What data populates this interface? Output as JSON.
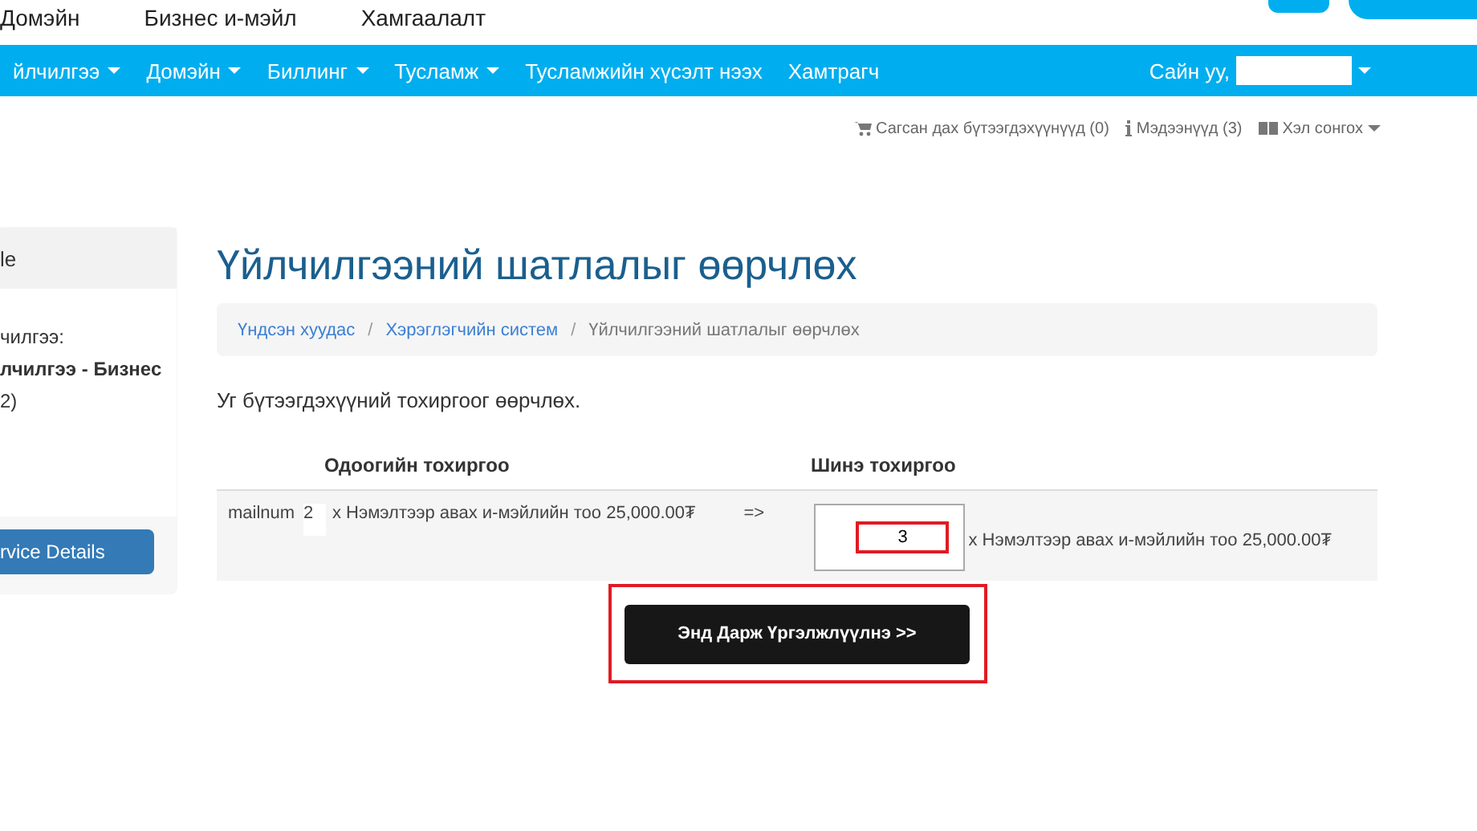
{
  "top_links": [
    "Домэйн",
    "Бизнес и-мэйл",
    "Хамгаалалт"
  ],
  "nav": {
    "items": [
      {
        "label": "йлчилгээ",
        "dropdown": true
      },
      {
        "label": "Домэйн",
        "dropdown": true
      },
      {
        "label": "Биллинг",
        "dropdown": true
      },
      {
        "label": "Тусламж",
        "dropdown": true
      },
      {
        "label": "Тусламжийн хүсэлт нээх",
        "dropdown": false
      },
      {
        "label": "Хамтрагч",
        "dropdown": false
      }
    ],
    "greeting": "Сайн уу,"
  },
  "utility_links": [
    {
      "kind": "cart",
      "label": "Сагсан дах бүтээгдэхүүнүүд (0)"
    },
    {
      "kind": "info",
      "label": "Мэдээнүүд (3)"
    },
    {
      "kind": "language",
      "label": "Хэл сонгох"
    }
  ],
  "sidebar": {
    "header": "le",
    "lines": [
      "чилгээ:",
      "лчилгээ - Бизнес",
      "2)"
    ],
    "button": "rvice Details"
  },
  "title": "Үйлчилгээний шатлалыг өөрчлөх",
  "breadcrumb": [
    {
      "label": "Үндсэн хуудас",
      "link": true
    },
    {
      "separator": "/",
      "label": "Хэрэглэгчийн систем",
      "link": true
    },
    {
      "separator": "/",
      "label": "Үйлчилгээний шатлалыг өөрчлөх",
      "link": false
    }
  ],
  "intro": "Уг бүтээгдэхүүний тохиргоог өөрчлөх.",
  "table": {
    "columns": [
      "Одоогийн тохиргоо",
      "Шинэ тохиргоо"
    ],
    "rows": [
      {
        "option": "mailnum",
        "current_value": "2",
        "current_desc": "x Нэмэлтээр авах и-мэйлийн тоо 25,000.00₮",
        "arrow": "=>",
        "new_value": "3",
        "new_desc": "x Нэмэлтээр авах и-мэйлийн тоо 25,000.00₮"
      }
    ]
  },
  "continue_button": "Энд Дарж Үргэлжлүүлнэ >>"
}
